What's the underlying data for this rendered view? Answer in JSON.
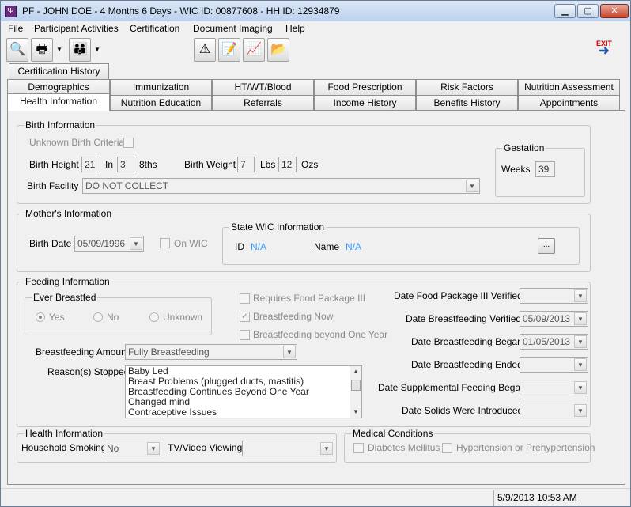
{
  "window": {
    "title": "PF - JOHN DOE - 4 Months 6 Days - WIC ID: 00877608 - HH ID: 12934879",
    "min_glyph": "▁",
    "max_glyph": "▢",
    "close_glyph": "✕"
  },
  "menu": [
    "File",
    "Participant Activities",
    "Certification",
    "Document Imaging",
    "Help"
  ],
  "toolbar": {
    "icons": [
      "search-icon",
      "print-icon",
      "family-icon",
      "alert-icon",
      "notes-icon",
      "growth-chart-icon",
      "folder-icon"
    ],
    "exit_label": "EXIT"
  },
  "tabs": {
    "row1": [
      "Certification History"
    ],
    "row2": [
      "Demographics",
      "Immunization",
      "HT/WT/Blood",
      "Food Prescription",
      "Risk Factors",
      "Nutrition Assessment"
    ],
    "row3": [
      "Health Information",
      "Nutrition Education",
      "Referrals",
      "Income History",
      "Benefits History",
      "Appointments"
    ]
  },
  "birth": {
    "legend": "Birth Information",
    "unknown_label": "Unknown Birth Criteria",
    "height_label": "Birth Height",
    "height_in": "21",
    "in_label": "In",
    "height_8ths": "3",
    "eighths_label": "8ths",
    "weight_label": "Birth Weight",
    "weight_lbs": "7",
    "lbs_label": "Lbs",
    "weight_ozs": "12",
    "ozs_label": "Ozs",
    "facility_label": "Birth Facility",
    "facility_value": "DO NOT COLLECT"
  },
  "gestation": {
    "legend": "Gestation",
    "weeks_label": "Weeks",
    "weeks_value": "39"
  },
  "mother": {
    "legend": "Mother's Information",
    "birth_date_label": "Birth Date",
    "birth_date_value": "05/09/1996",
    "on_wic_label": "On WIC",
    "state_legend": "State WIC Information",
    "id_label": "ID",
    "id_value": "N/A",
    "name_label": "Name",
    "name_value": "N/A",
    "browse_label": "..."
  },
  "feeding": {
    "legend": "Feeding Information",
    "ever_legend": "Ever Breastfed",
    "yes_label": "Yes",
    "no_label": "No",
    "unknown_label": "Unknown",
    "requires_pkg3_label": "Requires Food Package III",
    "bf_now_label": "Breastfeeding Now",
    "bf_beyond_label": "Breastfeeding beyond One Year",
    "amount_label": "Breastfeeding Amount",
    "amount_value": "Fully Breastfeeding",
    "reasons_label": "Reason(s) Stopped",
    "reasons": [
      "Baby Led",
      "Breast Problems (plugged ducts, mastitis)",
      "Breastfeeding Continues Beyond One Year",
      "Changed mind",
      "Contraceptive Issues"
    ],
    "date_pkg3_label": "Date Food Package III Verified",
    "date_pkg3_value": "",
    "date_bf_verified_label": "Date Breastfeeding Verified",
    "date_bf_verified_value": "05/09/2013",
    "date_bf_began_label": "Date Breastfeeding Began",
    "date_bf_began_value": "01/05/2013",
    "date_bf_ended_label": "Date Breastfeeding Ended",
    "date_bf_ended_value": "",
    "date_supp_label": "Date Supplemental Feeding Began",
    "date_supp_value": "",
    "date_solids_label": "Date Solids Were Introduced",
    "date_solids_value": ""
  },
  "health": {
    "legend": "Health Information",
    "smoking_label": "Household Smoking",
    "smoking_value": "No",
    "tv_label": "TV/Video Viewing",
    "tv_value": ""
  },
  "medical": {
    "legend": "Medical Conditions",
    "diabetes_label": "Diabetes Mellitus",
    "hypertension_label": "Hypertension or Prehypertension"
  },
  "status": {
    "datetime": "5/9/2013    10:53 AM"
  }
}
